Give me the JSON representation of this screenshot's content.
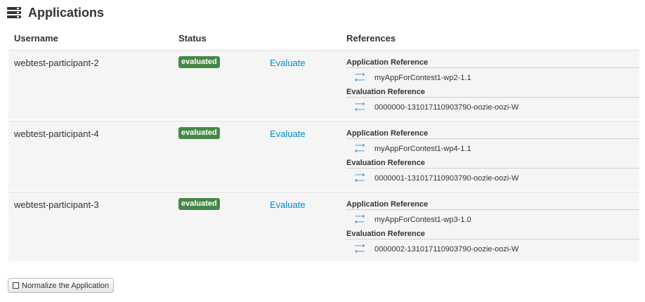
{
  "page": {
    "title": "Applications",
    "icon": "list-server-icon"
  },
  "table": {
    "headers": {
      "username": "Username",
      "status": "Status",
      "references": "References"
    },
    "rows": [
      {
        "username": "webtest-participant-2",
        "status": "evaluated",
        "action": "Evaluate",
        "app_ref_heading": "Application Reference",
        "app_ref": "myAppForContest1-wp2-1.1",
        "eval_ref_heading": "Evaluation Reference",
        "eval_ref": "0000000-131017110903790-oozie-oozi-W"
      },
      {
        "username": "webtest-participant-4",
        "status": "evaluated",
        "action": "Evaluate",
        "app_ref_heading": "Application Reference",
        "app_ref": "myAppForContest1-wp4-1.1",
        "eval_ref_heading": "Evaluation Reference",
        "eval_ref": "0000001-131017110903790-oozie-oozi-W"
      },
      {
        "username": "webtest-participant-3",
        "status": "evaluated",
        "action": "Evaluate",
        "app_ref_heading": "Application Reference",
        "app_ref": "myAppForContest1-wp3-1.0",
        "eval_ref_heading": "Evaluation Reference",
        "eval_ref": "0000002-131017110903790-oozie-oozi-W"
      }
    ]
  },
  "normalize_button": {
    "label": "Normalize the Application"
  },
  "colors": {
    "badge": "#468847",
    "link": "#0088cc",
    "row_bg": "#f5f5f5",
    "swap_icon": "#1a7fc1"
  }
}
